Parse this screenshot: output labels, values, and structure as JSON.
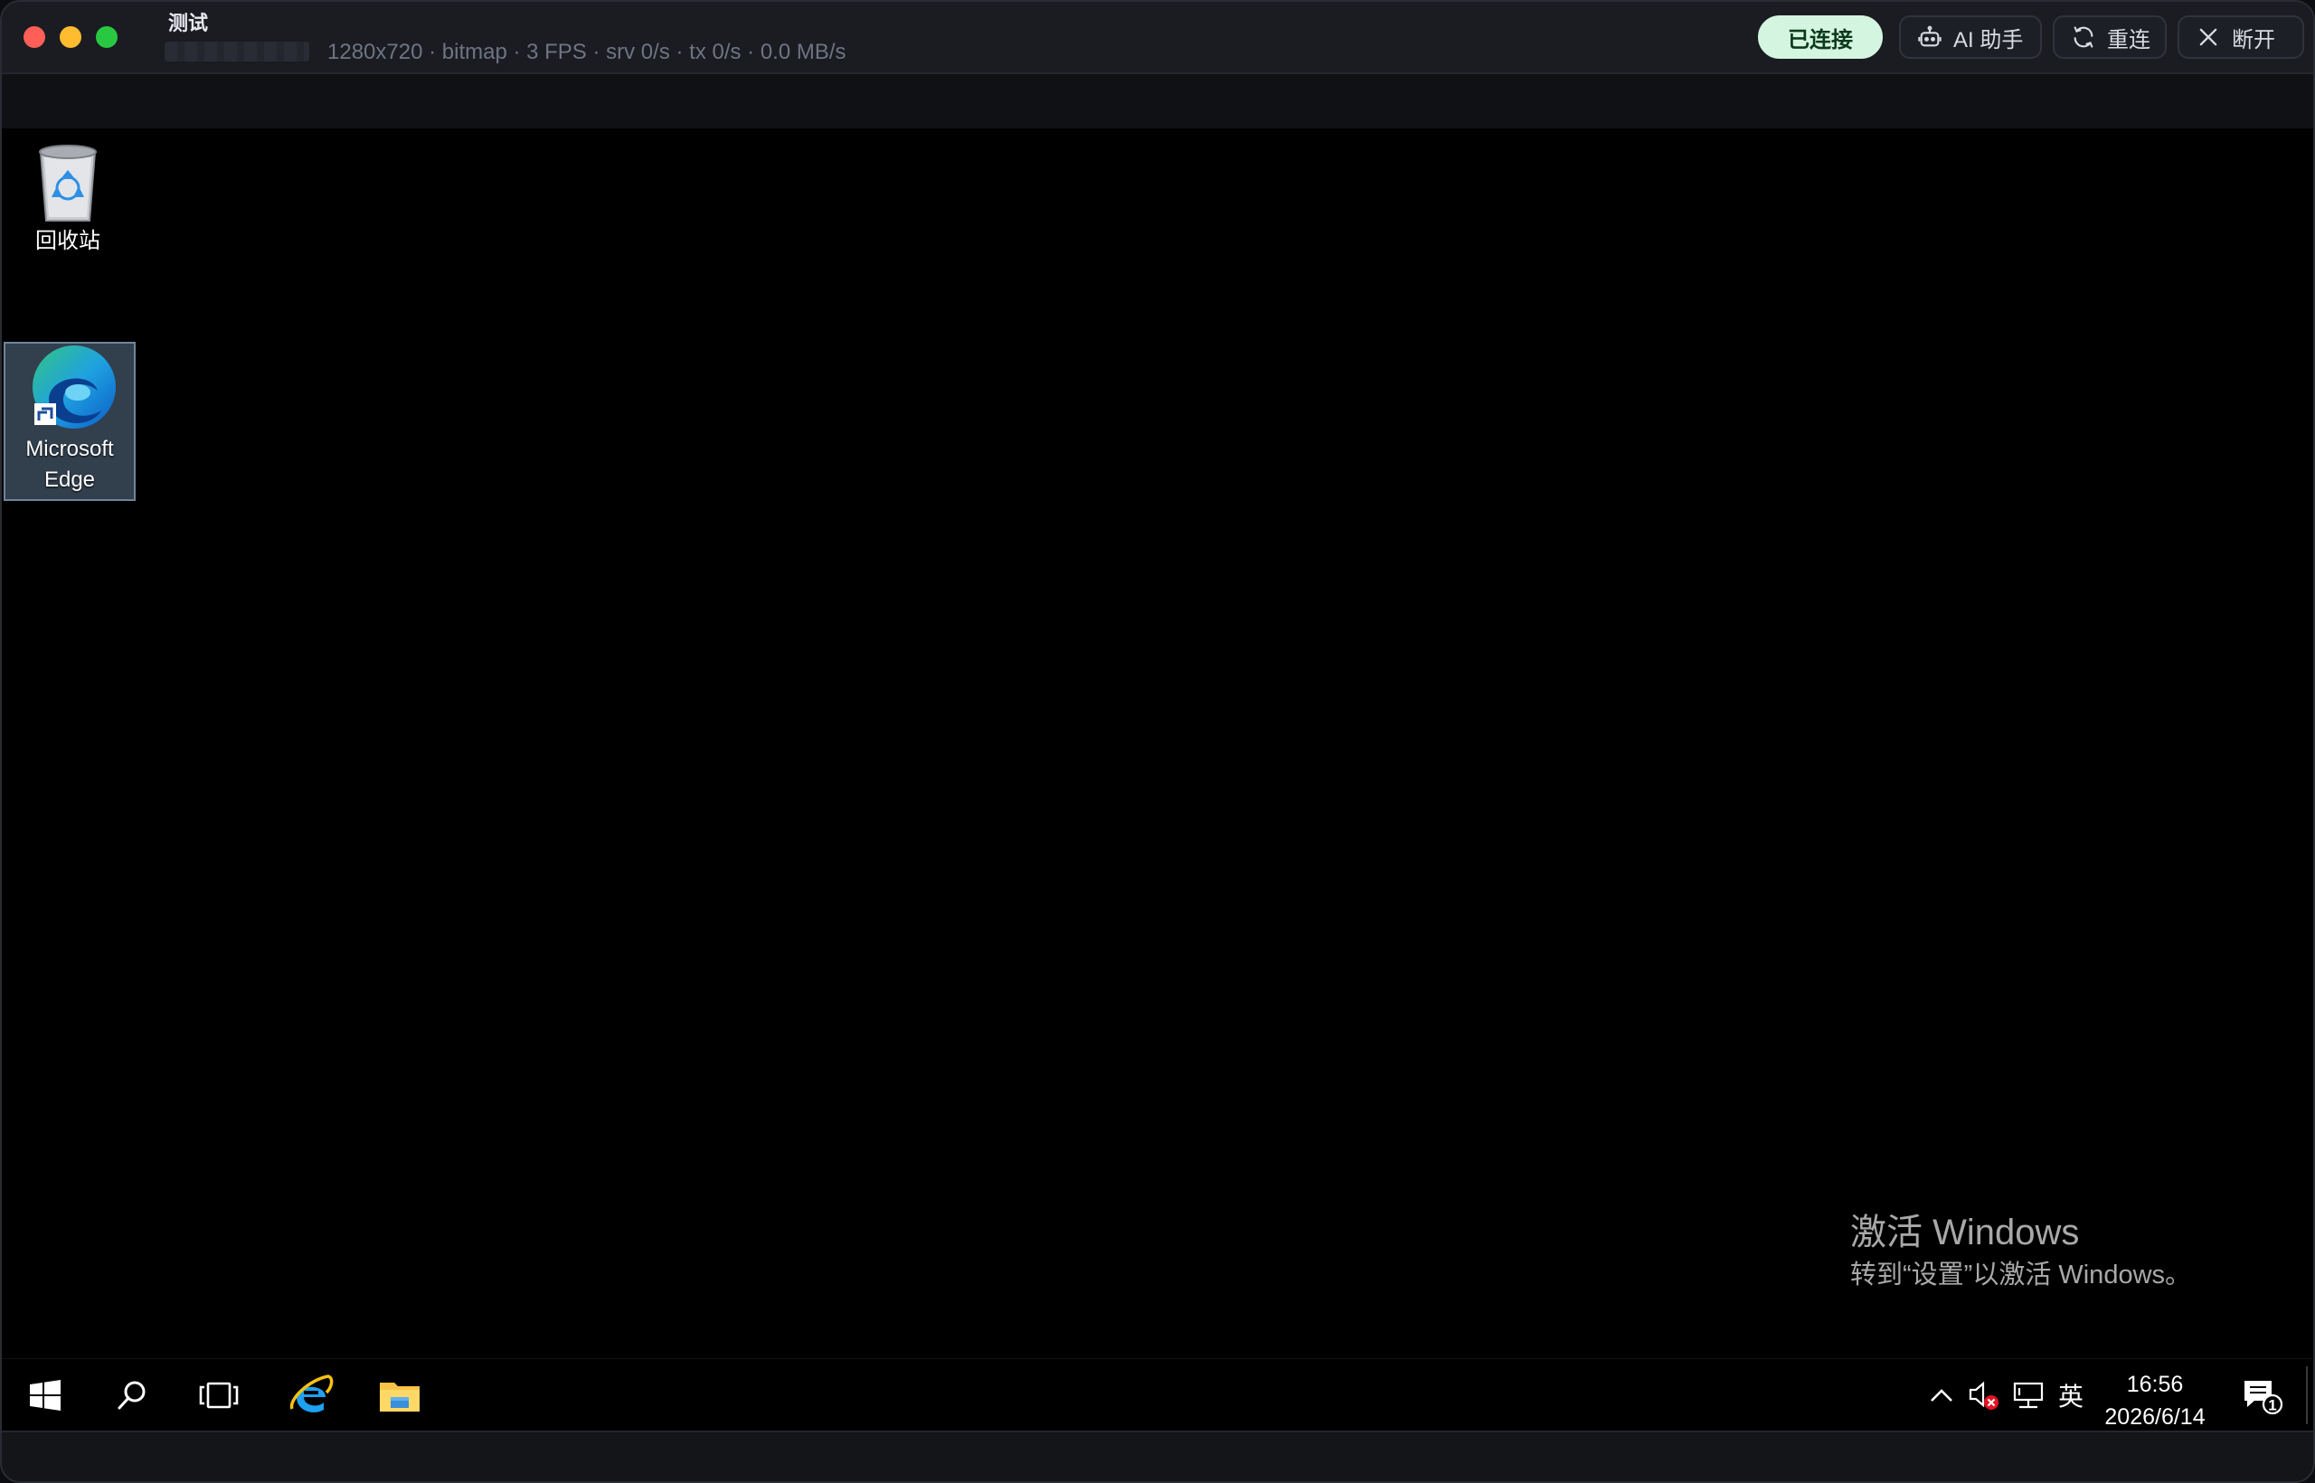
{
  "window": {
    "title": "测试",
    "stats": "1280x720 · bitmap · 3 FPS · srv 0/s · tx 0/s · 0.0 MB/s"
  },
  "toolbar": {
    "status_label": "已连接",
    "ai_label": "AI 助手",
    "reconnect_label": "重连",
    "disconnect_label": "断开"
  },
  "desktop": {
    "icons": [
      {
        "label": "回收站",
        "icon": "recycle-bin-icon"
      },
      {
        "label": "Microsoft Edge",
        "icon": "edge-icon",
        "selected": true
      }
    ],
    "watermark": {
      "title": "激活 Windows",
      "subtitle": "转到“设置”以激活 Windows。"
    }
  },
  "taskbar": {
    "items": [
      "windows-start-icon",
      "search-icon",
      "task-view-icon",
      "internet-explorer-icon",
      "file-explorer-icon"
    ],
    "tray": {
      "ime": "英",
      "time": "16:56",
      "date": "2026/6/14",
      "notification_count": "1"
    }
  },
  "colors": {
    "connected_bg": "#d4f5df",
    "titlebar_bg": "#1a1c22",
    "desktop_bg": "#000000"
  }
}
